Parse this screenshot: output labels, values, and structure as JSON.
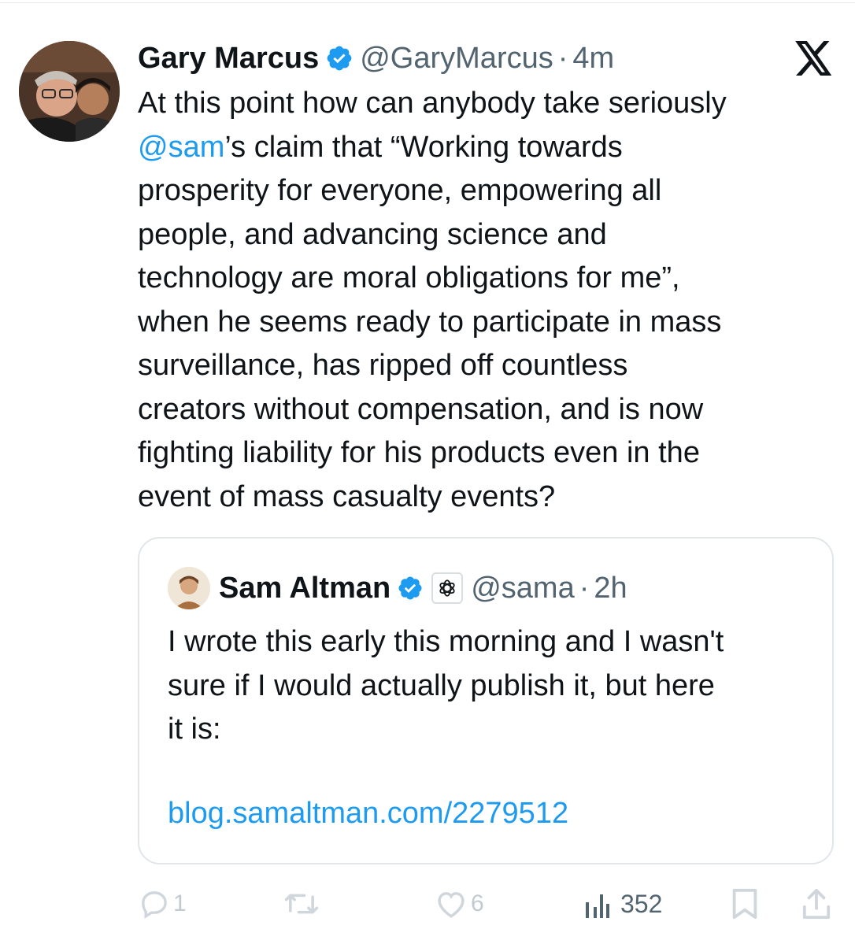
{
  "tweet": {
    "author_name": "Gary Marcus",
    "handle": "@GaryMarcus",
    "separator": "·",
    "time": "4m",
    "mention": "@sam",
    "text_lines": [
      "At this point how can anybody take seriously",
      "’s claim that “Working towards",
      "prosperity for everyone, empowering all",
      "people, and advancing science and",
      "technology are moral obligations for me”,",
      "when he seems ready to participate in mass",
      "surveillance, has ripped off countless",
      "creators without compensation, and is now",
      "fighting liability for his products even in the",
      "event of mass casualty events?"
    ]
  },
  "quote": {
    "author_name": "Sam Altman",
    "handle": "@sama",
    "separator": "·",
    "time": "2h",
    "text_lines": [
      "I wrote this early this morning and I wasn't",
      "sure if I would actually publish it, but here",
      "it is:"
    ],
    "link": "blog.samaltman.com/2279512"
  },
  "actions": {
    "replies": "1",
    "likes": "6",
    "views": "352"
  },
  "icons": [
    "verified-badge-icon",
    "x-logo-icon",
    "openai-affiliation-icon",
    "reply-icon",
    "retweet-icon",
    "like-icon",
    "views-icon",
    "bookmark-icon",
    "share-icon"
  ],
  "colors": {
    "link": "#1d9bf0",
    "verified": "#1d9bf0",
    "secondary_text": "#536471"
  }
}
